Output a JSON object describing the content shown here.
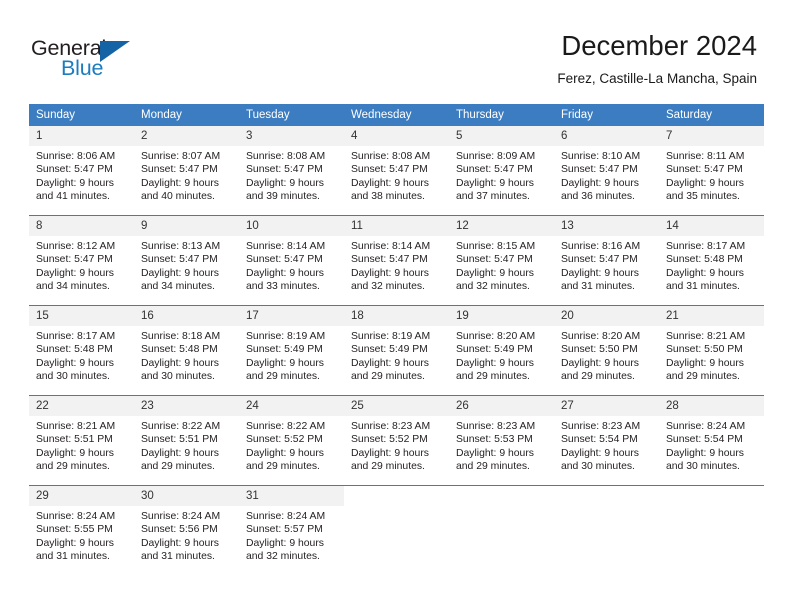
{
  "brand": {
    "name_part1": "General",
    "name_part2": "Blue",
    "accent_color": "#1c7cc0",
    "triangle_color": "#1464a5"
  },
  "header": {
    "title": "December 2024",
    "subtitle": "Ferez, Castille-La Mancha, Spain"
  },
  "calendar": {
    "header_bg": "#3b7dc0",
    "daynum_bg": "#f2f2f2",
    "weekday_headers": [
      "Sunday",
      "Monday",
      "Tuesday",
      "Wednesday",
      "Thursday",
      "Friday",
      "Saturday"
    ],
    "weeks": [
      [
        {
          "day": "1",
          "sunrise": "Sunrise: 8:06 AM",
          "sunset": "Sunset: 5:47 PM",
          "daylight_line1": "Daylight: 9 hours",
          "daylight_line2": "and 41 minutes."
        },
        {
          "day": "2",
          "sunrise": "Sunrise: 8:07 AM",
          "sunset": "Sunset: 5:47 PM",
          "daylight_line1": "Daylight: 9 hours",
          "daylight_line2": "and 40 minutes."
        },
        {
          "day": "3",
          "sunrise": "Sunrise: 8:08 AM",
          "sunset": "Sunset: 5:47 PM",
          "daylight_line1": "Daylight: 9 hours",
          "daylight_line2": "and 39 minutes."
        },
        {
          "day": "4",
          "sunrise": "Sunrise: 8:08 AM",
          "sunset": "Sunset: 5:47 PM",
          "daylight_line1": "Daylight: 9 hours",
          "daylight_line2": "and 38 minutes."
        },
        {
          "day": "5",
          "sunrise": "Sunrise: 8:09 AM",
          "sunset": "Sunset: 5:47 PM",
          "daylight_line1": "Daylight: 9 hours",
          "daylight_line2": "and 37 minutes."
        },
        {
          "day": "6",
          "sunrise": "Sunrise: 8:10 AM",
          "sunset": "Sunset: 5:47 PM",
          "daylight_line1": "Daylight: 9 hours",
          "daylight_line2": "and 36 minutes."
        },
        {
          "day": "7",
          "sunrise": "Sunrise: 8:11 AM",
          "sunset": "Sunset: 5:47 PM",
          "daylight_line1": "Daylight: 9 hours",
          "daylight_line2": "and 35 minutes."
        }
      ],
      [
        {
          "day": "8",
          "sunrise": "Sunrise: 8:12 AM",
          "sunset": "Sunset: 5:47 PM",
          "daylight_line1": "Daylight: 9 hours",
          "daylight_line2": "and 34 minutes."
        },
        {
          "day": "9",
          "sunrise": "Sunrise: 8:13 AM",
          "sunset": "Sunset: 5:47 PM",
          "daylight_line1": "Daylight: 9 hours",
          "daylight_line2": "and 34 minutes."
        },
        {
          "day": "10",
          "sunrise": "Sunrise: 8:14 AM",
          "sunset": "Sunset: 5:47 PM",
          "daylight_line1": "Daylight: 9 hours",
          "daylight_line2": "and 33 minutes."
        },
        {
          "day": "11",
          "sunrise": "Sunrise: 8:14 AM",
          "sunset": "Sunset: 5:47 PM",
          "daylight_line1": "Daylight: 9 hours",
          "daylight_line2": "and 32 minutes."
        },
        {
          "day": "12",
          "sunrise": "Sunrise: 8:15 AM",
          "sunset": "Sunset: 5:47 PM",
          "daylight_line1": "Daylight: 9 hours",
          "daylight_line2": "and 32 minutes."
        },
        {
          "day": "13",
          "sunrise": "Sunrise: 8:16 AM",
          "sunset": "Sunset: 5:47 PM",
          "daylight_line1": "Daylight: 9 hours",
          "daylight_line2": "and 31 minutes."
        },
        {
          "day": "14",
          "sunrise": "Sunrise: 8:17 AM",
          "sunset": "Sunset: 5:48 PM",
          "daylight_line1": "Daylight: 9 hours",
          "daylight_line2": "and 31 minutes."
        }
      ],
      [
        {
          "day": "15",
          "sunrise": "Sunrise: 8:17 AM",
          "sunset": "Sunset: 5:48 PM",
          "daylight_line1": "Daylight: 9 hours",
          "daylight_line2": "and 30 minutes."
        },
        {
          "day": "16",
          "sunrise": "Sunrise: 8:18 AM",
          "sunset": "Sunset: 5:48 PM",
          "daylight_line1": "Daylight: 9 hours",
          "daylight_line2": "and 30 minutes."
        },
        {
          "day": "17",
          "sunrise": "Sunrise: 8:19 AM",
          "sunset": "Sunset: 5:49 PM",
          "daylight_line1": "Daylight: 9 hours",
          "daylight_line2": "and 29 minutes."
        },
        {
          "day": "18",
          "sunrise": "Sunrise: 8:19 AM",
          "sunset": "Sunset: 5:49 PM",
          "daylight_line1": "Daylight: 9 hours",
          "daylight_line2": "and 29 minutes."
        },
        {
          "day": "19",
          "sunrise": "Sunrise: 8:20 AM",
          "sunset": "Sunset: 5:49 PM",
          "daylight_line1": "Daylight: 9 hours",
          "daylight_line2": "and 29 minutes."
        },
        {
          "day": "20",
          "sunrise": "Sunrise: 8:20 AM",
          "sunset": "Sunset: 5:50 PM",
          "daylight_line1": "Daylight: 9 hours",
          "daylight_line2": "and 29 minutes."
        },
        {
          "day": "21",
          "sunrise": "Sunrise: 8:21 AM",
          "sunset": "Sunset: 5:50 PM",
          "daylight_line1": "Daylight: 9 hours",
          "daylight_line2": "and 29 minutes."
        }
      ],
      [
        {
          "day": "22",
          "sunrise": "Sunrise: 8:21 AM",
          "sunset": "Sunset: 5:51 PM",
          "daylight_line1": "Daylight: 9 hours",
          "daylight_line2": "and 29 minutes."
        },
        {
          "day": "23",
          "sunrise": "Sunrise: 8:22 AM",
          "sunset": "Sunset: 5:51 PM",
          "daylight_line1": "Daylight: 9 hours",
          "daylight_line2": "and 29 minutes."
        },
        {
          "day": "24",
          "sunrise": "Sunrise: 8:22 AM",
          "sunset": "Sunset: 5:52 PM",
          "daylight_line1": "Daylight: 9 hours",
          "daylight_line2": "and 29 minutes."
        },
        {
          "day": "25",
          "sunrise": "Sunrise: 8:23 AM",
          "sunset": "Sunset: 5:52 PM",
          "daylight_line1": "Daylight: 9 hours",
          "daylight_line2": "and 29 minutes."
        },
        {
          "day": "26",
          "sunrise": "Sunrise: 8:23 AM",
          "sunset": "Sunset: 5:53 PM",
          "daylight_line1": "Daylight: 9 hours",
          "daylight_line2": "and 29 minutes."
        },
        {
          "day": "27",
          "sunrise": "Sunrise: 8:23 AM",
          "sunset": "Sunset: 5:54 PM",
          "daylight_line1": "Daylight: 9 hours",
          "daylight_line2": "and 30 minutes."
        },
        {
          "day": "28",
          "sunrise": "Sunrise: 8:24 AM",
          "sunset": "Sunset: 5:54 PM",
          "daylight_line1": "Daylight: 9 hours",
          "daylight_line2": "and 30 minutes."
        }
      ],
      [
        {
          "day": "29",
          "sunrise": "Sunrise: 8:24 AM",
          "sunset": "Sunset: 5:55 PM",
          "daylight_line1": "Daylight: 9 hours",
          "daylight_line2": "and 31 minutes."
        },
        {
          "day": "30",
          "sunrise": "Sunrise: 8:24 AM",
          "sunset": "Sunset: 5:56 PM",
          "daylight_line1": "Daylight: 9 hours",
          "daylight_line2": "and 31 minutes."
        },
        {
          "day": "31",
          "sunrise": "Sunrise: 8:24 AM",
          "sunset": "Sunset: 5:57 PM",
          "daylight_line1": "Daylight: 9 hours",
          "daylight_line2": "and 32 minutes."
        },
        {
          "day": "",
          "sunrise": "",
          "sunset": "",
          "daylight_line1": "",
          "daylight_line2": ""
        },
        {
          "day": "",
          "sunrise": "",
          "sunset": "",
          "daylight_line1": "",
          "daylight_line2": ""
        },
        {
          "day": "",
          "sunrise": "",
          "sunset": "",
          "daylight_line1": "",
          "daylight_line2": ""
        },
        {
          "day": "",
          "sunrise": "",
          "sunset": "",
          "daylight_line1": "",
          "daylight_line2": ""
        }
      ]
    ]
  }
}
